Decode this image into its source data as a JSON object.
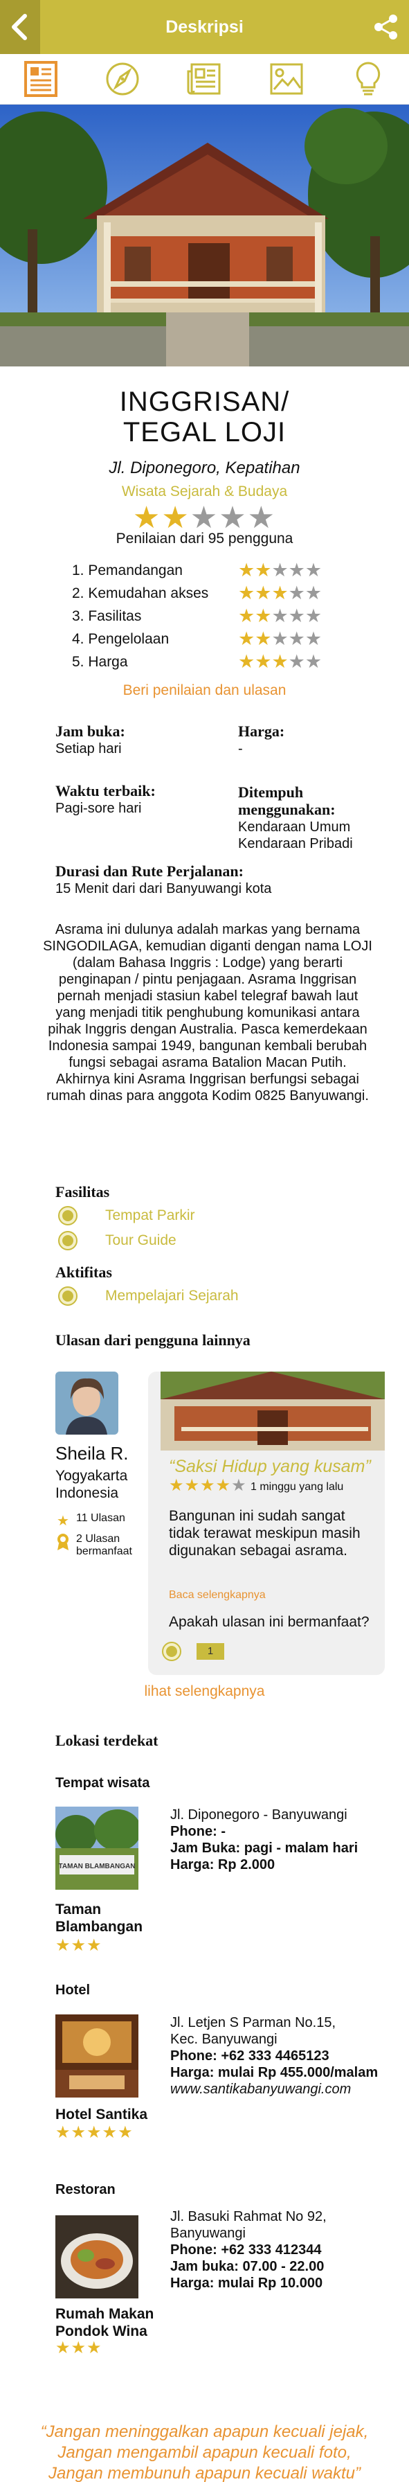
{
  "header": {
    "title": "Deskripsi"
  },
  "icons": [
    "document-icon",
    "compass-icon",
    "news-icon",
    "gallery-icon",
    "lightbulb-icon"
  ],
  "place": {
    "title_line1": "INGGRISAN/",
    "title_line2": "TEGAL LOJI",
    "address": "Jl. Diponegoro, Kepatihan",
    "category": "Wisata Sejarah & Budaya",
    "rating_stars": 2,
    "rating_count_text": "Penilaian dari 95 pengguna"
  },
  "ratings": [
    {
      "label": "1. Pemandangan",
      "stars": 2
    },
    {
      "label": "2. Kemudahan akses",
      "stars": 3
    },
    {
      "label": "3. Fasilitas",
      "stars": 2
    },
    {
      "label": "4. Pengelolaan",
      "stars": 2
    },
    {
      "label": "5. Harga",
      "stars": 3
    }
  ],
  "rate_link": "Beri penilaian dan ulasan",
  "info": {
    "jam_buka_label": "Jam buka:",
    "jam_buka_value": "Setiap hari",
    "harga_label": "Harga:",
    "harga_value": "-",
    "waktu_label": "Waktu terbaik:",
    "waktu_value": "Pagi-sore hari",
    "ditempuh_label": "Ditempuh menggunakan:",
    "ditempuh_value1": "Kendaraan Umum",
    "ditempuh_value2": "Kendaraan Pribadi",
    "durasi_label": "Durasi dan Rute Perjalanan:",
    "durasi_value": "15 Menit dari dari Banyuwangi kota"
  },
  "description": "Asrama ini dulunya adalah markas yang bernama SINGODILAGA, kemudian diganti dengan nama LOJI (dalam Bahasa Inggris : Lodge) yang berarti penginapan / pintu penjagaan.  Asrama Inggrisan pernah menjadi stasiun kabel telegraf bawah laut yang menjadi titik penghubung komunikasi antara pihak Inggris dengan Australia. Pasca kemerdekaan Indonesia sampai 1949, bangunan kembali berubah fungsi sebagai  asrama Batalion Macan Putih. Akhirnya kini Asrama Inggrisan berfungsi sebagai rumah dinas para anggota Kodim 0825 Banyuwangi.",
  "facilities": {
    "title": "Fasilitas",
    "items": [
      "Tempat Parkir",
      "Tour Guide"
    ]
  },
  "activities": {
    "title": "Aktifitas",
    "items": [
      "Mempelajari Sejarah"
    ]
  },
  "reviews": {
    "title": "Ulasan dari pengguna lainnya",
    "user_name": "Sheila R.",
    "user_city1": "Yogyakarta",
    "user_city2": "Indonesia",
    "user_reviews": "11 Ulasan",
    "user_helpful1": "2 Ulasan",
    "user_helpful2": "bermanfaat",
    "quote": "“Saksi Hidup yang kusam”",
    "stars": 4,
    "when": "1 minggu yang lalu",
    "body": "Bangunan ini sudah sangat tidak terawat meskipun masih digunakan sebagai asrama.",
    "read_more": "Baca selengkapnya",
    "ask": "Apakah ulasan ini bermanfaat?",
    "yes_count": "1",
    "see_more": "lihat selengkapnya"
  },
  "nearby": {
    "title": "Lokasi terdekat",
    "wisata_label": "Tempat wisata",
    "wisata_name1": "Taman",
    "wisata_name2": "Blambangan",
    "wisata_addr": "Jl. Diponegoro - Banyuwangi",
    "wisata_phone": "Phone: -",
    "wisata_jam": "Jam Buka: pagi - malam hari",
    "wisata_harga": "Harga: Rp 2.000",
    "wisata_stars": 3,
    "wisata_sign": "TAMAN BLAMBANGAN",
    "hotel_label": "Hotel",
    "hotel_name": "Hotel Santika",
    "hotel_addr1": "Jl. Letjen S Parman No.15,",
    "hotel_addr2": "Kec. Banyuwangi",
    "hotel_phone": "Phone: +62 333 4465123",
    "hotel_harga": "Harga: mulai Rp 455.000/malam",
    "hotel_web": "www.santikabanyuwangi.com",
    "hotel_stars": 5,
    "resto_label": "Restoran",
    "resto_name1": "Rumah Makan",
    "resto_name2": "Pondok Wina",
    "resto_addr1": "Jl. Basuki Rahmat No 92,",
    "resto_addr2": "Banyuwangi",
    "resto_phone": "Phone: +62 333 412344",
    "resto_jam": "Jam buka: 07.00 - 22.00",
    "resto_harga": "Harga: mulai Rp 10.000",
    "resto_stars": 3
  },
  "footer": {
    "line1": "“Jangan meninggalkan apapun kecuali jejak,",
    "line2": "Jangan mengambil apapun kecuali foto,",
    "line3": "Jangan membunuh apapun kecuali waktu”"
  },
  "colors": {
    "brand": "#c9bb3e",
    "accent_orange": "#e89332",
    "star_on": "#e5b526",
    "star_off": "#9a9a9a"
  }
}
